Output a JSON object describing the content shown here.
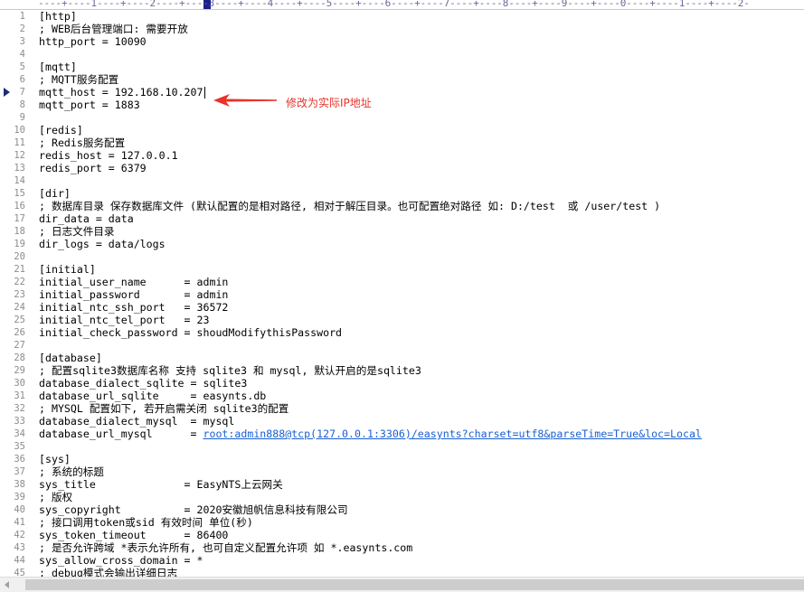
{
  "ruler": {
    "text": "----+----1----+----2----+----3----+----4----+----5----+----6----+----7----+----8----+----9----+----0----+----1----+----2-"
  },
  "annotation": {
    "text": "修改为实际IP地址",
    "color": "#e8322a"
  },
  "editor": {
    "current_line": 7,
    "lines": [
      {
        "n": "1",
        "text": "[http]"
      },
      {
        "n": "2",
        "text": "; WEB后台管理端口: 需要开放"
      },
      {
        "n": "3",
        "text": "http_port = 10090"
      },
      {
        "n": "4",
        "text": ""
      },
      {
        "n": "5",
        "text": "[mqtt]"
      },
      {
        "n": "6",
        "text": "; MQTT服务配置"
      },
      {
        "n": "7",
        "text": "mqtt_host = 192.168.10.207"
      },
      {
        "n": "8",
        "text": "mqtt_port = 1883"
      },
      {
        "n": "9",
        "text": ""
      },
      {
        "n": "10",
        "text": "[redis]"
      },
      {
        "n": "11",
        "text": "; Redis服务配置"
      },
      {
        "n": "12",
        "text": "redis_host = 127.0.0.1"
      },
      {
        "n": "13",
        "text": "redis_port = 6379"
      },
      {
        "n": "14",
        "text": ""
      },
      {
        "n": "15",
        "text": "[dir]"
      },
      {
        "n": "16",
        "text": "; 数据库目录 保存数据库文件 (默认配置的是相对路径, 相对于解压目录。也可配置绝对路径 如: D:/test  或 /user/test )"
      },
      {
        "n": "17",
        "text": "dir_data = data"
      },
      {
        "n": "18",
        "text": "; 日志文件目录"
      },
      {
        "n": "19",
        "text": "dir_logs = data/logs"
      },
      {
        "n": "20",
        "text": ""
      },
      {
        "n": "21",
        "text": "[initial]"
      },
      {
        "n": "22",
        "text": "initial_user_name      = admin"
      },
      {
        "n": "23",
        "text": "initial_password       = admin"
      },
      {
        "n": "24",
        "text": "initial_ntc_ssh_port   = 36572"
      },
      {
        "n": "25",
        "text": "initial_ntc_tel_port   = 23"
      },
      {
        "n": "26",
        "text": "initial_check_password = shoudModifythisPassword"
      },
      {
        "n": "27",
        "text": ""
      },
      {
        "n": "28",
        "text": "[database]"
      },
      {
        "n": "29",
        "text": "; 配置sqlite3数据库名称 支持 sqlite3 和 mysql, 默认开启的是sqlite3"
      },
      {
        "n": "30",
        "text": "database_dialect_sqlite = sqlite3"
      },
      {
        "n": "31",
        "text": "database_url_sqlite     = easynts.db"
      },
      {
        "n": "32",
        "text": "; MYSQL 配置如下, 若开启需关闭 sqlite3的配置"
      },
      {
        "n": "33",
        "text": "database_dialect_mysql  = mysql"
      },
      {
        "n": "34",
        "text": "database_url_mysql      = ",
        "link": "root:admin888@tcp(127.0.0.1:3306)/easynts?charset=utf8&parseTime=True&loc=Local"
      },
      {
        "n": "35",
        "text": ""
      },
      {
        "n": "36",
        "text": "[sys]"
      },
      {
        "n": "37",
        "text": "; 系统的标题"
      },
      {
        "n": "38",
        "text": "sys_title              = EasyNTS上云网关"
      },
      {
        "n": "39",
        "text": "; 版权"
      },
      {
        "n": "40",
        "text": "sys_copyright          = 2020安徽旭帆信息科技有限公司"
      },
      {
        "n": "41",
        "text": "; 接口调用token或sid 有效时间 单位(秒)"
      },
      {
        "n": "42",
        "text": "sys_token_timeout      = 86400"
      },
      {
        "n": "43",
        "text": "; 是否允许跨域 *表示允许所有, 也可自定义配置允许项 如 *.easynts.com"
      },
      {
        "n": "44",
        "text": "sys_allow_cross_domain = *"
      },
      {
        "n": "45",
        "text": "; debug模式会输出详细日志"
      }
    ]
  }
}
